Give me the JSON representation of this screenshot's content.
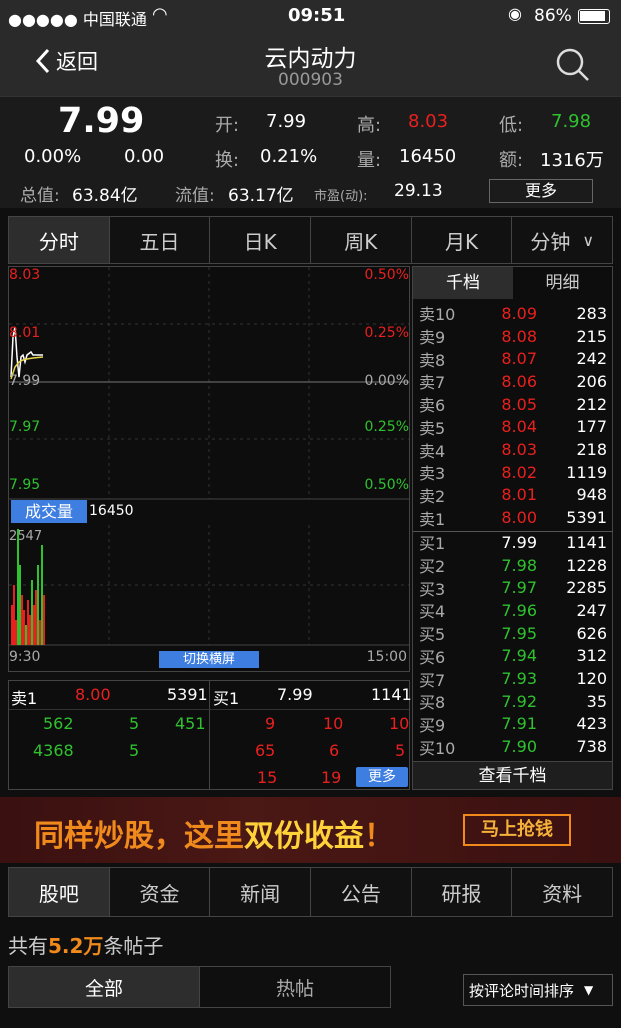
{
  "status": {
    "carrier": "●●●●● 中国联通",
    "time": "09:51",
    "battery": "86%"
  },
  "nav": {
    "back": "返回",
    "title": "云内动力",
    "code": "000903"
  },
  "quote": {
    "price": "7.99",
    "change_pct": "0.00%",
    "change": "0.00",
    "open_lbl": "开:",
    "open": "7.99",
    "high_lbl": "高:",
    "high": "8.03",
    "low_lbl": "低:",
    "low": "7.98",
    "turn_lbl": "换:",
    "turn": "0.21%",
    "vol_lbl": "量:",
    "vol": "16450",
    "amt_lbl": "额:",
    "amt": "1316万",
    "mcap_lbl": "总值:",
    "mcap": "63.84亿",
    "float_lbl": "流值:",
    "float": "63.17亿",
    "pe_lbl": "市盈(动):",
    "pe": "29.13",
    "more": "更多"
  },
  "tabs": [
    "分时",
    "五日",
    "日K",
    "周K",
    "月K",
    "分钟"
  ],
  "chart": {
    "y_left": [
      "8.03",
      "8.01",
      "7.99",
      "7.97",
      "7.95"
    ],
    "y_right": [
      "0.50%",
      "0.25%",
      "0.00%",
      "0.25%",
      "0.50%"
    ],
    "vol_btn": "成交量",
    "vol_val": "16450",
    "vol_max": "2547",
    "t_start": "9:30",
    "t_end": "15:00",
    "landscape": "切换横屏"
  },
  "trade": {
    "sell_lbl": "卖1",
    "sell_px": "8.00",
    "sell_vol": "5391",
    "buy_lbl": "买1",
    "buy_px": "7.99",
    "buy_vol": "1141",
    "left_rows": [
      [
        "562",
        "5",
        "451"
      ],
      [
        "4368",
        "5",
        ""
      ]
    ],
    "right_rows": [
      [
        "9",
        "10",
        "10"
      ],
      [
        "65",
        "6",
        "5"
      ],
      [
        "15",
        "19",
        ""
      ]
    ],
    "more": "更多"
  },
  "orderbook": {
    "tabs": [
      "千档",
      "明细"
    ],
    "asks": [
      [
        "卖10",
        "8.09",
        "283"
      ],
      [
        "卖9",
        "8.08",
        "215"
      ],
      [
        "卖8",
        "8.07",
        "242"
      ],
      [
        "卖7",
        "8.06",
        "206"
      ],
      [
        "卖6",
        "8.05",
        "212"
      ],
      [
        "卖5",
        "8.04",
        "177"
      ],
      [
        "卖4",
        "8.03",
        "218"
      ],
      [
        "卖3",
        "8.02",
        "1119"
      ],
      [
        "卖2",
        "8.01",
        "948"
      ],
      [
        "卖1",
        "8.00",
        "5391"
      ]
    ],
    "bids": [
      [
        "买1",
        "7.99",
        "1141"
      ],
      [
        "买2",
        "7.98",
        "1228"
      ],
      [
        "买3",
        "7.97",
        "2285"
      ],
      [
        "买4",
        "7.96",
        "247"
      ],
      [
        "买5",
        "7.95",
        "626"
      ],
      [
        "买6",
        "7.94",
        "312"
      ],
      [
        "买7",
        "7.93",
        "120"
      ],
      [
        "买8",
        "7.92",
        "35"
      ],
      [
        "买9",
        "7.91",
        "423"
      ],
      [
        "买10",
        "7.90",
        "738"
      ]
    ],
    "view_all": "查看千档"
  },
  "banner": {
    "text1": "同样炒股，这里",
    "text2": "双份收益",
    "text3": "！",
    "button": "马上抢钱"
  },
  "bottom_tabs": [
    "股吧",
    "资金",
    "新闻",
    "公告",
    "研报",
    "资料"
  ],
  "posts": {
    "prefix": "共有",
    "count": "5.2万",
    "suffix": "条帖子",
    "tab_all": "全部",
    "tab_hot": "热帖",
    "sort": "按评论时间排序"
  },
  "colors": {
    "red": "#e8201e",
    "green": "#2fc22f",
    "accent": "#3d7ee0",
    "banner_orange": "#f08a1c"
  }
}
